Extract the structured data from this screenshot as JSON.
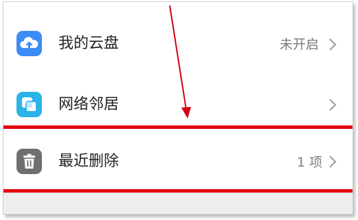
{
  "menu": {
    "items": [
      {
        "label": "我的云盘",
        "value": "未开启",
        "icon": "cloud-drive-icon"
      },
      {
        "label": "网络邻居",
        "value": "",
        "icon": "network-neighbor-icon"
      },
      {
        "label": "最近删除",
        "value": "1 项",
        "icon": "trash-icon"
      }
    ]
  },
  "annotation": {
    "highlight_color": "#e3000b",
    "arrow": "pointing to 最近删除 row"
  },
  "colors": {
    "cloud_icon_bg": "#3d8cf5",
    "network_icon_bg": "#2bb3e8",
    "trash_icon_bg": "#6f6f6f"
  }
}
